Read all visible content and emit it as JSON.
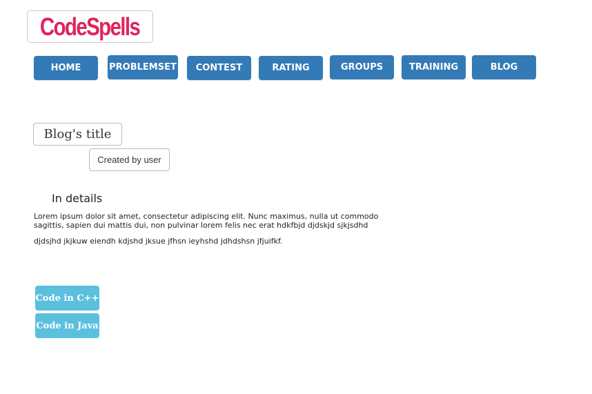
{
  "brand": {
    "logo_text": "CodeSpells",
    "logo_color": "#e0245e"
  },
  "nav": {
    "color": "#337ab7",
    "items": [
      {
        "label": "HOME"
      },
      {
        "label": "PROBLEMSET"
      },
      {
        "label": "CONTEST"
      },
      {
        "label": "RATING"
      },
      {
        "label": "GROUPS"
      },
      {
        "label": "TRAINING"
      },
      {
        "label": "BLOG"
      }
    ]
  },
  "post": {
    "title": "Blog's title",
    "author_label": "Created by user",
    "details_heading": "In details",
    "paragraphs": [
      "Lorem ipsum dolor sit amet, consectetur adipiscing elit. Nunc maximus, nulla ut commodo sagittis, sapien dui mattis dui, non pulvinar lorem felis nec erat hdkfbjd djdskjd sjkjsdhd",
      "djdsjhd jkjkuw eiendh kdjshd jksue jfhsn ieyhshd jdhdshsn jfjuifkf."
    ]
  },
  "code_buttons": {
    "color": "#5bc0de",
    "cpp_label": "Code in C++",
    "java_label": "Code in Java"
  }
}
